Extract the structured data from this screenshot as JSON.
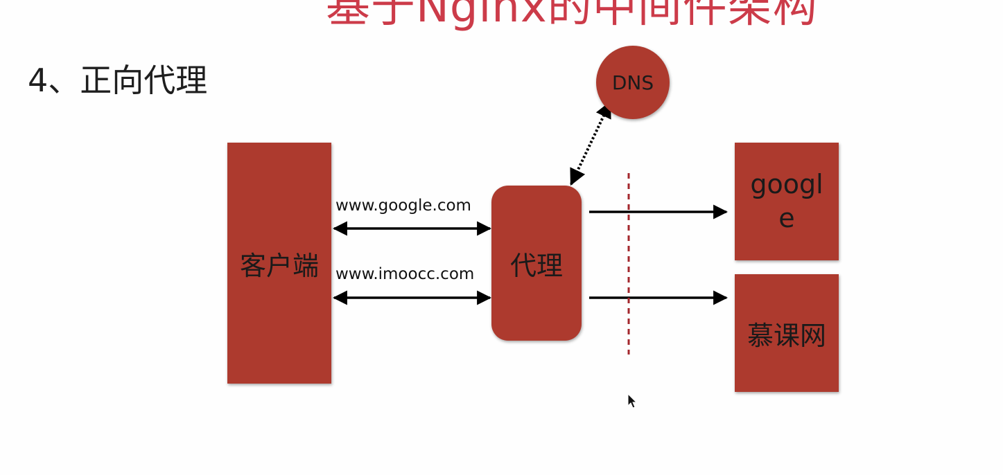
{
  "slide": {
    "title": "基于Nginx的中间件架构",
    "heading": "4、正向代理"
  },
  "diagram": {
    "nodes": {
      "client": "客户端",
      "proxy": "代理",
      "dns": "DNS",
      "google": "google",
      "imooc": "慕课网"
    },
    "edge_labels": {
      "google_request": "www.google.com",
      "imooc_request": "www.imoocc.com"
    }
  },
  "colors": {
    "node_fill": "#ad3a2e",
    "title": "#cc3b49",
    "boundary_line": "#a3262c",
    "arrow": "#000000"
  },
  "icons": {
    "cursor": "mouse-pointer-icon"
  }
}
